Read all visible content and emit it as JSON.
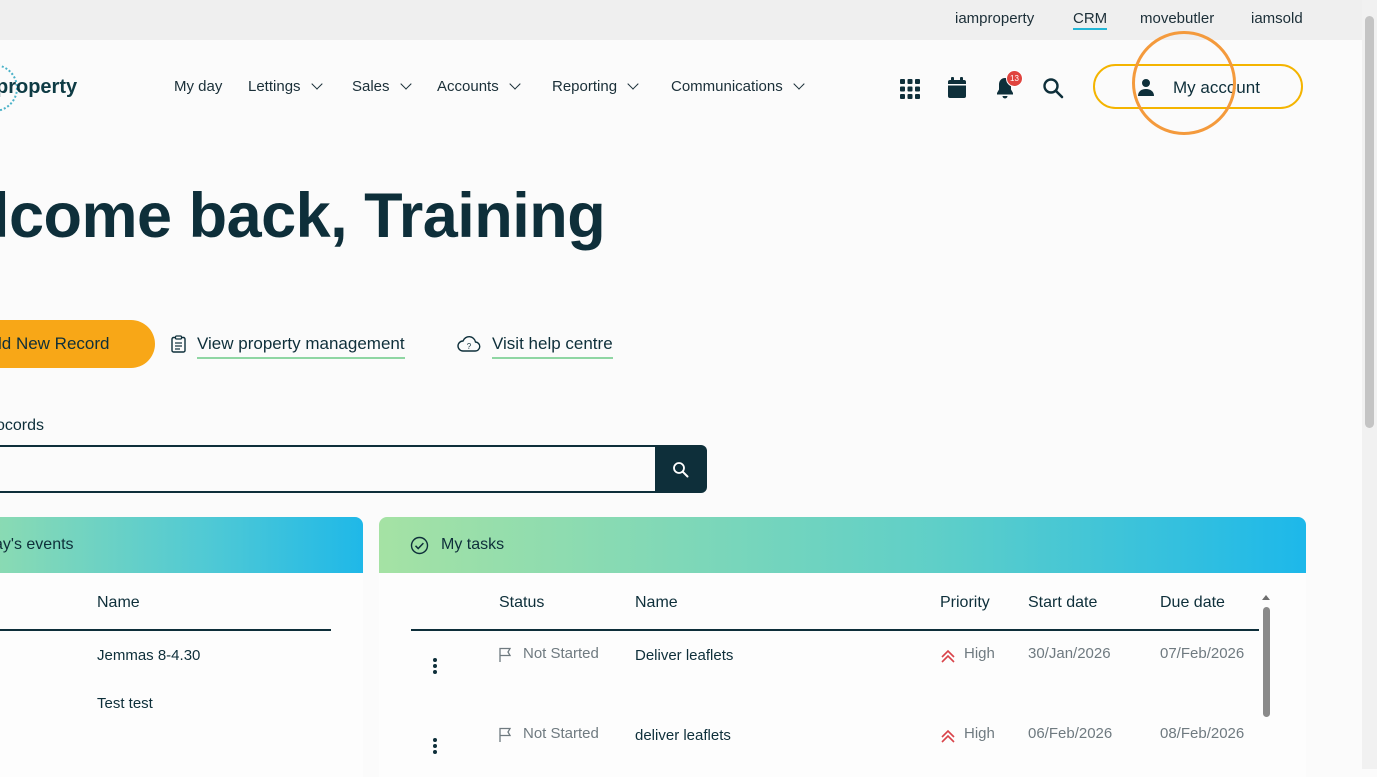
{
  "topbar": {
    "links": [
      {
        "label": "iamproperty",
        "active": false
      },
      {
        "label": "CRM",
        "active": true
      },
      {
        "label": "movebutler",
        "active": false
      },
      {
        "label": "iamsold",
        "active": false
      }
    ]
  },
  "header": {
    "logo_text": "property",
    "nav": [
      {
        "label": "My day",
        "dropdown": false
      },
      {
        "label": "Lettings",
        "dropdown": true
      },
      {
        "label": "Sales",
        "dropdown": true
      },
      {
        "label": "Accounts",
        "dropdown": true
      },
      {
        "label": "Reporting",
        "dropdown": true
      },
      {
        "label": "Communications",
        "dropdown": true
      }
    ],
    "icons": [
      "apps-grid-icon",
      "calendar-icon",
      "bell-icon",
      "search-icon"
    ],
    "notification_count": "13",
    "account_label": "My account"
  },
  "main": {
    "welcome": "lcome back, Training",
    "add_record_label": "ld New Record",
    "view_property_management": "View property management",
    "visit_help_centre": "Visit help centre",
    "search_label": "ocords",
    "search_placeholder": ""
  },
  "events": {
    "title": "ay's events",
    "column_name": "Name",
    "rows": [
      "Jemmas 8-4.30",
      "Test test"
    ]
  },
  "tasks": {
    "title": "My tasks",
    "columns": [
      "Status",
      "Name",
      "Priority",
      "Start date",
      "Due date"
    ],
    "rows": [
      {
        "status": "Not Started",
        "name": "Deliver leaflets",
        "priority": "High",
        "start": "30/Jan/2026",
        "due": "07/Feb/2026"
      },
      {
        "status": "Not Started",
        "name": "deliver leaflets",
        "priority": "High",
        "start": "06/Feb/2026",
        "due": "08/Feb/2026"
      }
    ]
  },
  "colors": {
    "accent_yellow": "#f8a717",
    "account_border": "#f4b400",
    "dark": "#0e2f3a",
    "priority_high": "#d9434a",
    "badge": "#e0443f"
  }
}
